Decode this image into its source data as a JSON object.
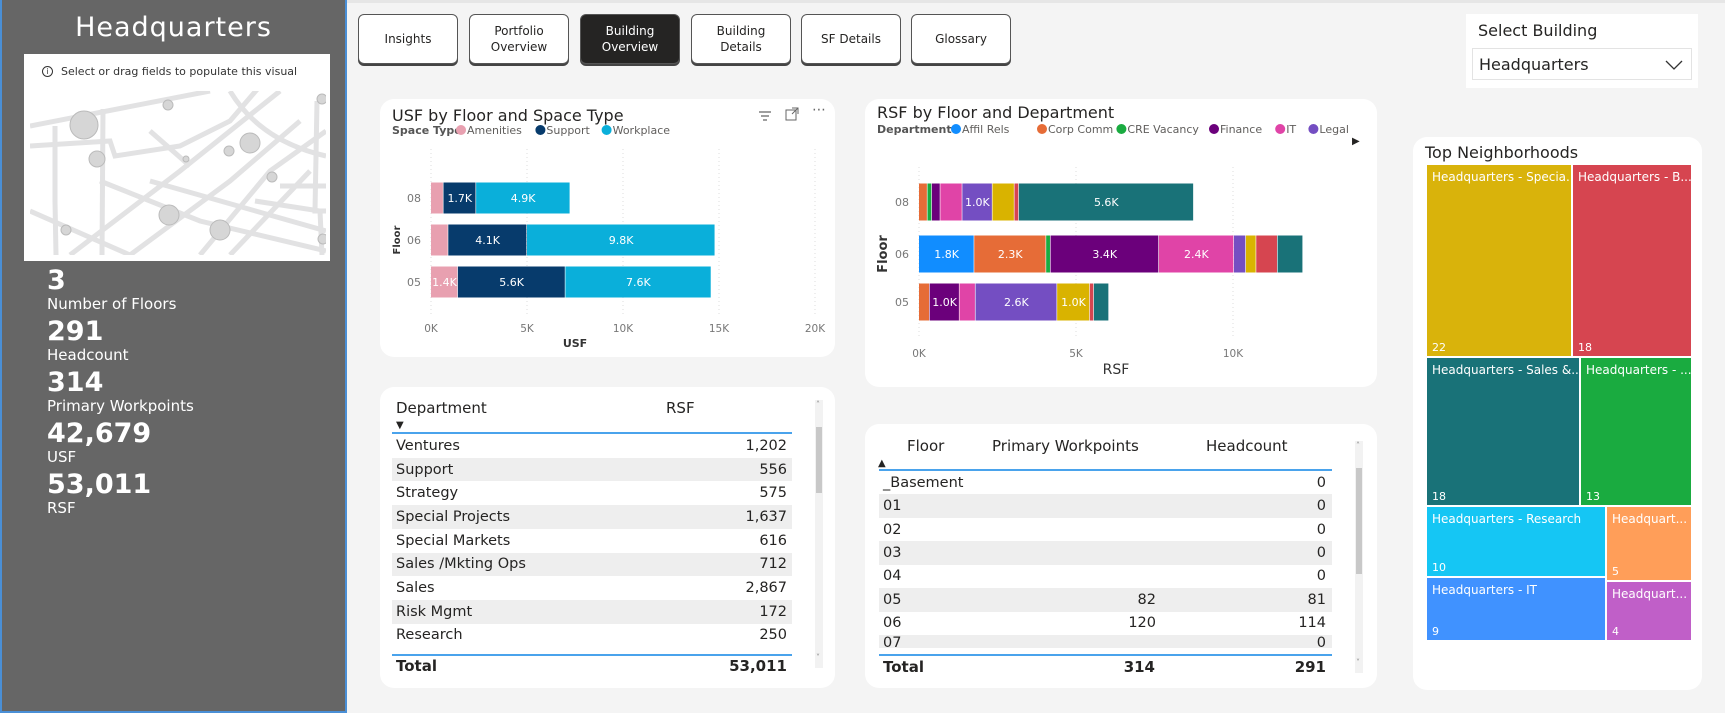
{
  "sidebar": {
    "title": "Headquarters",
    "map_message": "Select or drag fields to populate this visual",
    "kpis": [
      {
        "value": "3",
        "label": "Number of Floors"
      },
      {
        "value": "291",
        "label": "Headcount"
      },
      {
        "value": "314",
        "label": "Primary Workpoints"
      },
      {
        "value": "42,679",
        "label": "USF"
      },
      {
        "value": "53,011",
        "label": "RSF"
      }
    ]
  },
  "nav": {
    "buttons": [
      "Insights",
      "Portfolio Overview",
      "Building Overview",
      "Building Details",
      "SF Details",
      "Glossary"
    ],
    "active": "Building Overview"
  },
  "select_building": {
    "label": "Select Building",
    "value": "Headquarters"
  },
  "chart_data": [
    {
      "type": "bar",
      "orientation": "horizontal-stacked",
      "title": "USF by Floor and Space Type",
      "legend_title": "Space Type",
      "legend_position": "top-left",
      "categories": [
        "08",
        "06",
        "05"
      ],
      "xlabel": "USF",
      "ylabel": "Floor",
      "xlim": [
        0,
        20000
      ],
      "xticks": [
        "0K",
        "5K",
        "10K",
        "15K",
        "20K"
      ],
      "grid": true,
      "series": [
        {
          "name": "Amenities",
          "color": "#E8A0B0",
          "values": [
            650,
            900,
            1400
          ],
          "labels": [
            "",
            "",
            "1.4K"
          ]
        },
        {
          "name": "Support",
          "color": "#073B6C",
          "values": [
            1700,
            4100,
            5600
          ],
          "labels": [
            "1.7K",
            "4.1K",
            "5.6K"
          ]
        },
        {
          "name": "Workplace",
          "color": "#0AAFDA",
          "values": [
            4900,
            9800,
            7600
          ],
          "labels": [
            "4.9K",
            "9.8K",
            "7.6K"
          ]
        }
      ]
    },
    {
      "type": "bar",
      "orientation": "horizontal-stacked",
      "title": "RSF by Floor and Department",
      "legend_title": "Department",
      "legend_position": "top-left",
      "categories": [
        "08",
        "06",
        "05"
      ],
      "xlabel": "RSF",
      "ylabel": "Floor",
      "xlim": [
        0,
        12500
      ],
      "xticks": [
        "0K",
        "5K",
        "10K"
      ],
      "grid": true,
      "series": [
        {
          "name": "Affil Rels",
          "color": "#118DFF",
          "values": [
            0,
            1760,
            0
          ],
          "labels": [
            "",
            "1.8K",
            ""
          ]
        },
        {
          "name": "Corp Comm",
          "color": "#E66C37",
          "values": [
            270,
            2290,
            340
          ],
          "labels": [
            "",
            "2.3K",
            ""
          ]
        },
        {
          "name": "CRE Vacancy",
          "color": "#1AAB40",
          "values": [
            140,
            140,
            0
          ],
          "labels": [
            "",
            "",
            ""
          ]
        },
        {
          "name": "Finance",
          "color": "#6B007B",
          "values": [
            270,
            3450,
            950
          ],
          "labels": [
            "",
            "3.4K",
            "1.0K"
          ]
        },
        {
          "name": "IT",
          "color": "#E044A7",
          "values": [
            700,
            2390,
            510
          ],
          "labels": [
            "",
            "2.4K",
            ""
          ]
        },
        {
          "name": "Legal",
          "color": "#744EC2",
          "values": [
            960,
            380,
            2600
          ],
          "labels": [
            "1.0K",
            "",
            "2.6K"
          ]
        },
        {
          "color": "#D9B300",
          "values": [
            700,
            330,
            1040
          ],
          "labels": [
            "",
            "",
            "1.0K"
          ]
        },
        {
          "color": "#D64550",
          "values": [
            140,
            680,
            130
          ],
          "labels": [
            "",
            "",
            ""
          ]
        },
        {
          "color": "#197278",
          "values": [
            5570,
            810,
            480
          ],
          "labels": [
            "5.6K",
            "",
            ""
          ]
        }
      ]
    }
  ],
  "dept_table": {
    "columns": [
      "Department",
      "RSF"
    ],
    "rows": [
      [
        "Ventures",
        "1,202"
      ],
      [
        "Support",
        "556"
      ],
      [
        "Strategy",
        "575"
      ],
      [
        "Special Projects",
        "1,637"
      ],
      [
        "Special Markets",
        "616"
      ],
      [
        "Sales /Mkting Ops",
        "712"
      ],
      [
        "Sales",
        "2,867"
      ],
      [
        "Risk Mgmt",
        "172"
      ],
      [
        "Research",
        "250"
      ]
    ],
    "total": [
      "Total",
      "53,011"
    ]
  },
  "floor_table": {
    "columns": [
      "Floor",
      "Primary Workpoints",
      "Headcount"
    ],
    "rows": [
      [
        "_Basement",
        "",
        "0"
      ],
      [
        "01",
        "",
        "0"
      ],
      [
        "02",
        "",
        "0"
      ],
      [
        "03",
        "",
        "0"
      ],
      [
        "04",
        "",
        "0"
      ],
      [
        "05",
        "82",
        "81"
      ],
      [
        "06",
        "120",
        "114"
      ],
      [
        "07",
        "",
        "0"
      ]
    ],
    "total": [
      "Total",
      "314",
      "291"
    ]
  },
  "treemap": {
    "title": "Top Neighborhoods",
    "tiles": [
      {
        "label": "Headquarters - Specia...",
        "value": "22",
        "color": "#D9B30B"
      },
      {
        "label": "Headquarters - B...",
        "value": "18",
        "color": "#D64550"
      },
      {
        "label": "Headquarters - Sales &...",
        "value": "18",
        "color": "#197278"
      },
      {
        "label": "Headquarters - ...",
        "value": "13",
        "color": "#1AAB40"
      },
      {
        "label": "Headquarters - Research",
        "value": "10",
        "color": "#15C6F4"
      },
      {
        "label": "Headquart...",
        "value": "5",
        "color": "#FF9E59"
      },
      {
        "label": "Headquarters - IT",
        "value": "9",
        "color": "#4092FF"
      },
      {
        "label": "Headquart...",
        "value": "4",
        "color": "#C05FC8"
      }
    ]
  }
}
